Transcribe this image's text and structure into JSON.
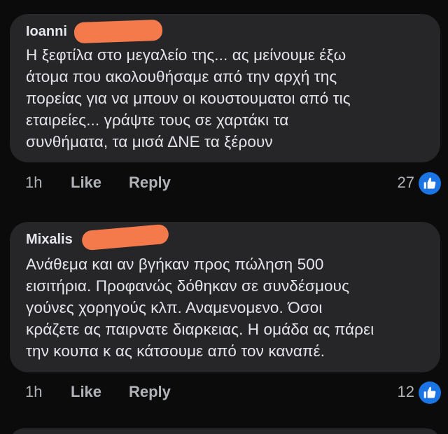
{
  "comments": [
    {
      "author": "Ioanni",
      "lines": [
        "Η ξεφτίλα στο μεγαλείο της... ας μείνουμε έξω",
        "άτομα που ακολουθήσαμε από την αρχή της",
        "πορείας για να μπουν οι κουστουματοι από τις",
        "εταιρείες... γράψτε τους σε χαρτάκι τα",
        "συνθήματα, τα μισά ΔΝΕ τα ξέρουν"
      ],
      "time": "1h",
      "like_label": "Like",
      "reply_label": "Reply",
      "reaction_count": "27",
      "reaction_icon": "thumbs-up-icon"
    },
    {
      "author": "Mixalis",
      "lines": [
        "Ανάθεμα και αν βγήκαν προς πώληση 500",
        "εισιτήρια. Προφανώς δόθηκαν σε συνδέσμους",
        "γούνες χορηγούς κλπ. Αναμενομενο. Όσοι",
        "κράζετε ας παιρνατε διαρκειας. Η ομάδα ας πάρει",
        "την κουπα κ ας κάτσουμε από τον καναπέ."
      ],
      "time": "1h",
      "like_label": "Like",
      "reply_label": "Reply",
      "reaction_count": "12",
      "reaction_icon": "thumbs-up-icon"
    }
  ],
  "colors": {
    "background": "#0b0b0c",
    "bubble": "#262628",
    "text": "#e4e6eb",
    "secondary_text": "#b0b3b8",
    "like_blue": "#1b74e4",
    "redaction": "#f47a4c"
  }
}
